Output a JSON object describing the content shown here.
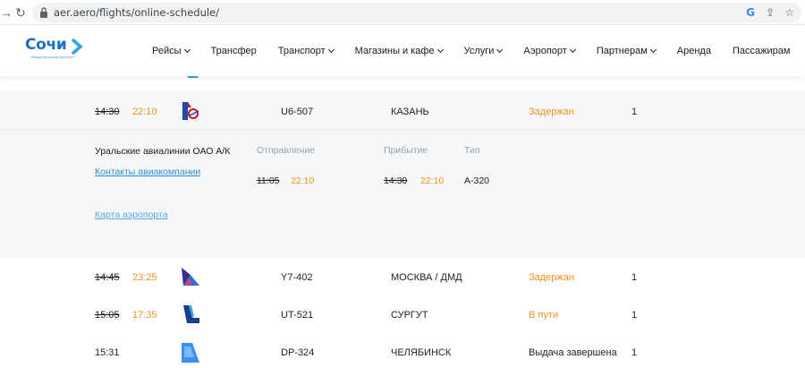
{
  "browser": {
    "url": "aer.aero/flights/online-schedule/"
  },
  "header": {
    "logo_text": "Сочи",
    "logo_sub": "международный аэропорт",
    "nav": [
      {
        "label": "Рейсы",
        "dropdown": true
      },
      {
        "label": "Трансфер",
        "dropdown": false
      },
      {
        "label": "Транспорт",
        "dropdown": true
      },
      {
        "label": "Магазины и кафе",
        "dropdown": true
      },
      {
        "label": "Услуги",
        "dropdown": true
      },
      {
        "label": "Аэропорт",
        "dropdown": true
      },
      {
        "label": "Партнерам",
        "dropdown": true
      },
      {
        "label": "Аренда",
        "dropdown": false
      },
      {
        "label": "Пассажирам",
        "dropdown": false
      }
    ]
  },
  "flights": [
    {
      "scheduled": "14:30",
      "actual": "22:10",
      "airline_icon": "ural-airlines-tail-icon",
      "flight": "U6-507",
      "city": "КАЗАНЬ",
      "status": "Задержан",
      "terminal": "1"
    },
    {
      "scheduled": "14:45",
      "actual": "23:25",
      "airline_icon": "azimuth-tail-icon",
      "flight": "Y7-402",
      "city": "МОСКВА / ДМД",
      "status": "Задержан",
      "terminal": "1"
    },
    {
      "scheduled": "15:05",
      "actual": "17:35",
      "airline_icon": "utair-tail-icon",
      "flight": "UT-521",
      "city": "СУРГУТ",
      "status": "В пути",
      "terminal": "1"
    },
    {
      "scheduled": "15:31",
      "actual": "",
      "airline_icon": "pobeda-tail-icon",
      "flight": "DP-324",
      "city": "ЧЕЛЯБИНСК",
      "status": "Выдача завершена",
      "terminal": "1"
    }
  ],
  "details": {
    "airline_name": "Уральские авиалинии ОАО А/К",
    "contacts_link": "Контакты авиакомпании",
    "map_link": "Карта аэропорта",
    "departure_label": "Отправление",
    "departure_scheduled": "11:05",
    "departure_actual": "22:10",
    "arrival_label": "Прибытие",
    "arrival_scheduled": "14:30",
    "arrival_actual": "22:10",
    "type_label": "Тип",
    "aircraft_type": "A-320"
  },
  "colors": {
    "accent": "#f39220",
    "link": "#2b8fd6",
    "brand": "#1b6fc6"
  }
}
